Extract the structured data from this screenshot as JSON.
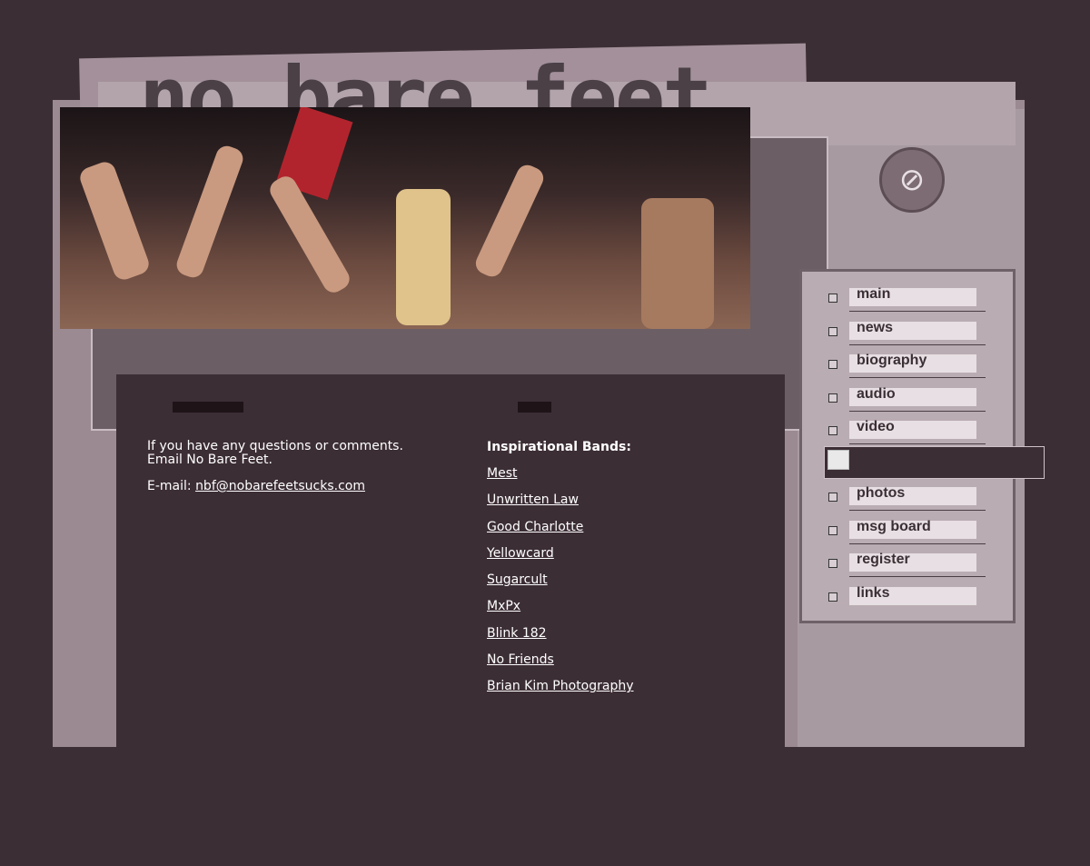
{
  "site": {
    "title": "no bare feet"
  },
  "nav": [
    {
      "label": "main"
    },
    {
      "label": "news"
    },
    {
      "label": "biography"
    },
    {
      "label": "audio"
    },
    {
      "label": "video"
    },
    {
      "label": ""
    },
    {
      "label": "photos"
    },
    {
      "label": "msg board"
    },
    {
      "label": "register"
    },
    {
      "label": "links"
    }
  ],
  "contact": {
    "line1": "If you have any questions or comments.",
    "line2": "Email No Bare Feet.",
    "email_prefix": "E-mail: ",
    "email": "nbf@nobarefeetsucks.com"
  },
  "bands": {
    "heading": "Inspirational Bands:",
    "items": [
      "Mest",
      "Unwritten Law",
      "Good Charlotte",
      "Yellowcard",
      "Sugarcult",
      "MxPx",
      "Blink 182",
      "No Friends",
      "Brian Kim Photography"
    ]
  },
  "colors": {
    "background": "#3c2e35",
    "frame": "#9b8a92",
    "text": "#ffffff"
  },
  "icons": {
    "logo": "no-bare-feet-icon",
    "broken_image": "broken-image-icon"
  }
}
